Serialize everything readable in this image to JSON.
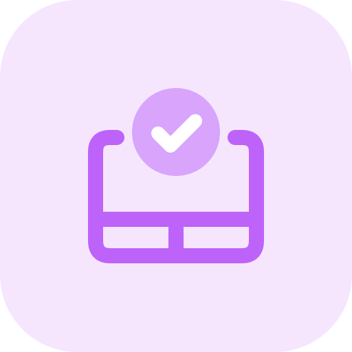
{
  "icon": {
    "name": "touchpad-check-icon",
    "colors": {
      "tile_background": "#f5e6fe",
      "outline": "#be63f9",
      "badge_fill": "#d8a4fc",
      "checkmark": "#ffffff"
    }
  }
}
